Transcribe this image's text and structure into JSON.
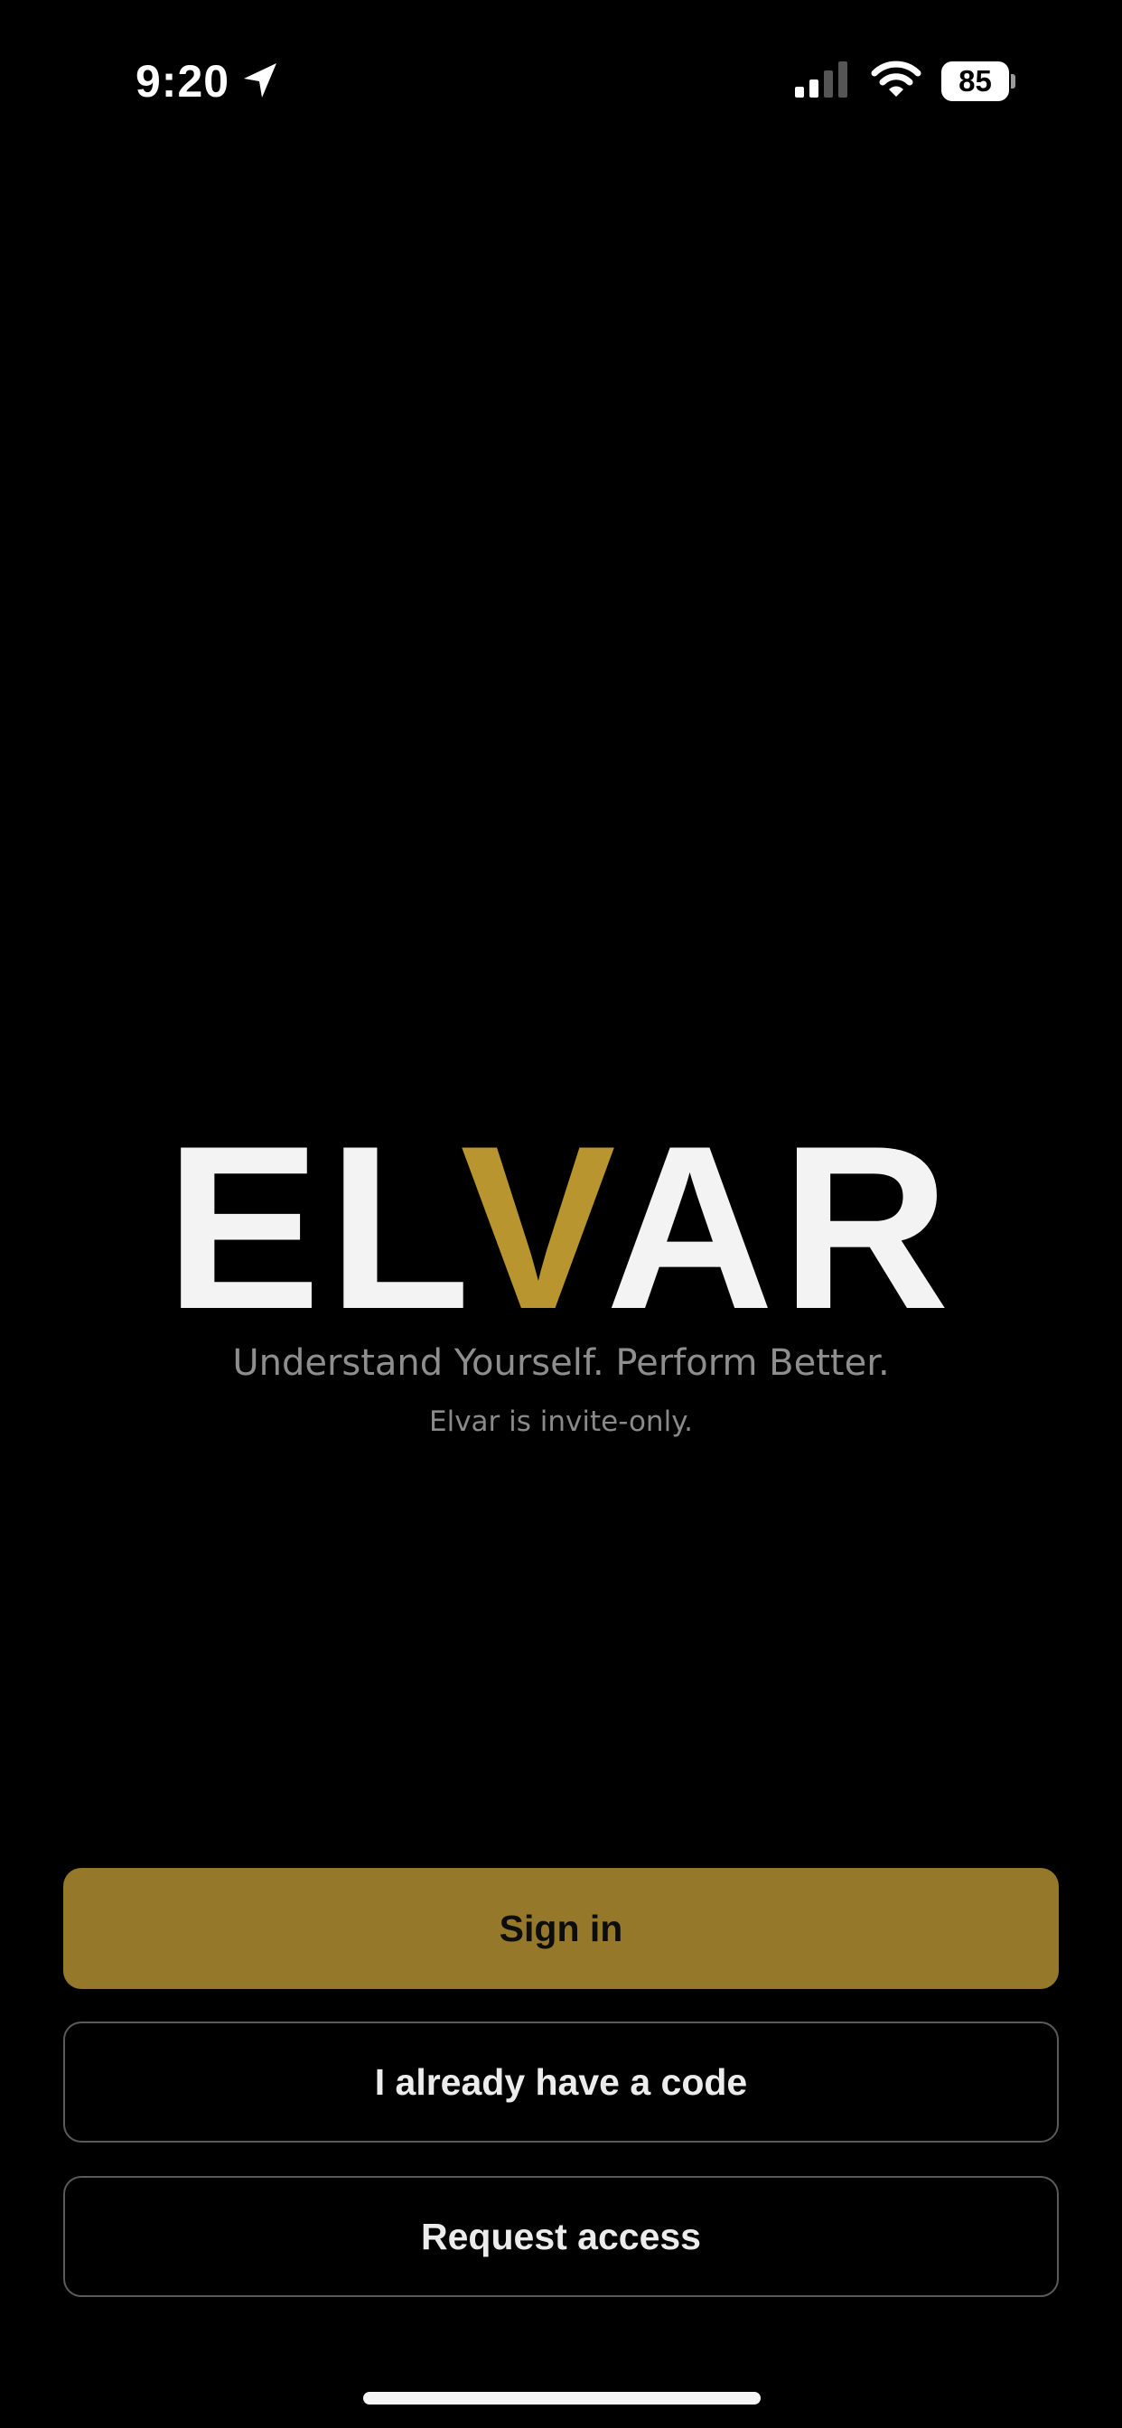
{
  "status_bar": {
    "time": "9:20",
    "battery_level": "85",
    "signal_bars_active": 2,
    "signal_bars_total": 4
  },
  "brand": {
    "logo_text_before": "EL",
    "logo_text_accent": "V",
    "logo_text_after": "AR",
    "tagline": "Understand Yourself. Perform Better.",
    "invite_note": "Elvar is invite-only."
  },
  "actions": {
    "sign_in_label": "Sign in",
    "have_code_label": "I already have a code",
    "request_access_label": "Request access"
  },
  "colors": {
    "background": "#000000",
    "accent_gold": "#b8952f",
    "primary_button": "#96782a",
    "button_border": "#5a5a5a",
    "secondary_text": "#8e8e8e"
  },
  "icons": {
    "location": "location-arrow-icon",
    "signal": "cellular-signal-icon",
    "wifi": "wifi-icon",
    "battery": "battery-icon"
  }
}
